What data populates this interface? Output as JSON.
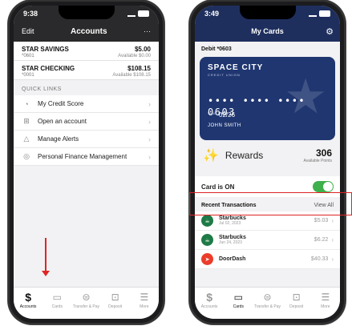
{
  "left": {
    "status_time": "9:38",
    "nav": {
      "edit": "Edit",
      "title": "Accounts",
      "more": "···"
    },
    "accounts": [
      {
        "name": "STAR SAVINGS",
        "number": "*0601",
        "balance": "$5.00",
        "available": "Available $0.00"
      },
      {
        "name": "STAR CHECKING",
        "number": "*0001",
        "balance": "$108.15",
        "available": "Available $108.15"
      }
    ],
    "quick_links_label": "QUICK LINKS",
    "quick_links": [
      {
        "label": "My Credit Score",
        "icon": "gauge-icon"
      },
      {
        "label": "Open an account",
        "icon": "plus-icon"
      },
      {
        "label": "Manage Alerts",
        "icon": "bell-icon"
      },
      {
        "label": "Personal Finance Management",
        "icon": "chart-icon"
      }
    ],
    "tabs": [
      {
        "label": "Accounts",
        "icon": "dollar-icon",
        "active": true
      },
      {
        "label": "Cards",
        "icon": "card-icon",
        "active": false
      },
      {
        "label": "Transfer & Pay",
        "icon": "transfer-icon",
        "active": false
      },
      {
        "label": "Deposit",
        "icon": "deposit-icon",
        "active": false
      },
      {
        "label": "More",
        "icon": "menu-icon",
        "active": false
      }
    ]
  },
  "right": {
    "status_time": "3:49",
    "nav": {
      "title": "My Cards"
    },
    "debit_label": "Debit *0603",
    "card": {
      "brand": "SPACE CITY",
      "brand_sub": "CREDIT UNION",
      "number": "•••• •••• •••• 0603",
      "valid_label": "VALID THRU",
      "expiry": "02/26",
      "holder": "JOHN SMITH"
    },
    "rewards": {
      "title": "Rewards",
      "points": "306",
      "points_label": "Available Points"
    },
    "card_on": {
      "label": "Card is ON",
      "enabled": true
    },
    "transactions_title": "Recent Transactions",
    "view_all": "View All",
    "transactions": [
      {
        "merchant": "Starbucks",
        "date": "Jul 02, 2023",
        "amount": "$5.03"
      },
      {
        "merchant": "Starbucks",
        "date": "Jun 24, 2023",
        "amount": "$6.22"
      },
      {
        "merchant": "DoorDash",
        "date": "",
        "amount": "$40.33"
      }
    ],
    "tabs": [
      {
        "label": "Accounts",
        "icon": "dollar-icon",
        "active": false
      },
      {
        "label": "Cards",
        "icon": "card-icon",
        "active": true
      },
      {
        "label": "Transfer & Pay",
        "icon": "transfer-icon",
        "active": false
      },
      {
        "label": "Deposit",
        "icon": "deposit-icon",
        "active": false
      },
      {
        "label": "More",
        "icon": "menu-icon",
        "active": false
      }
    ]
  },
  "colors": {
    "accent_red": "#e02424",
    "card_blue": "#1f3670",
    "toggle_green": "#3fb04b"
  }
}
